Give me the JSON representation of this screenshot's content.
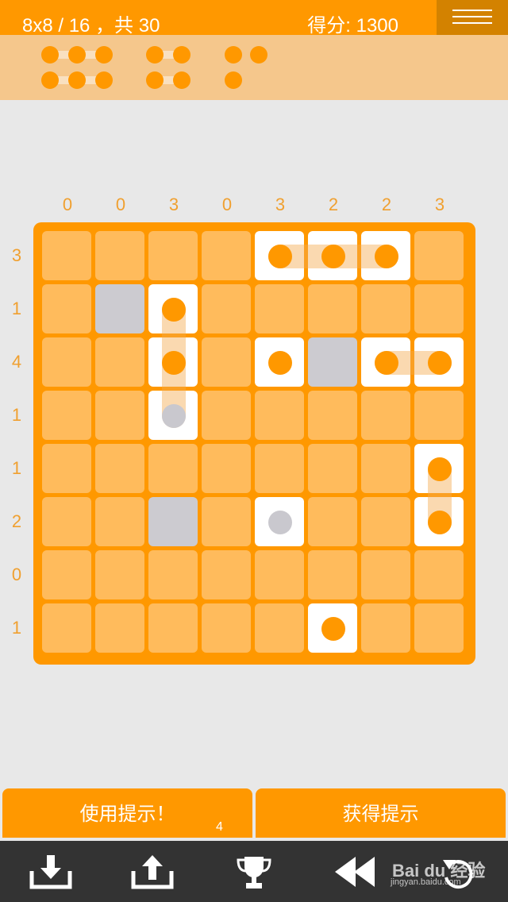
{
  "header": {
    "level_info": "8x8 / 16 ，共 30",
    "score": "得分: 1300",
    "menu_icon": "hamburger-menu-icon"
  },
  "fleet": {
    "ships": [
      {
        "size": 3,
        "found": false
      },
      {
        "size": 3,
        "found": false
      },
      {
        "size": 2,
        "found": false
      },
      {
        "size": 2,
        "found": false
      },
      {
        "size": 1,
        "found": false
      },
      {
        "size": 1,
        "found": false
      },
      {
        "size": 1,
        "found": false
      }
    ]
  },
  "puzzle": {
    "col_clues": [
      "0",
      "0",
      "3",
      "0",
      "3",
      "2",
      "2",
      "3"
    ],
    "row_clues": [
      "3",
      "1",
      "4",
      "1",
      "1",
      "2",
      "0",
      "1"
    ],
    "grid": [
      [
        "e",
        "e",
        "e",
        "e",
        "s",
        "s",
        "s",
        "e"
      ],
      [
        "e",
        "w",
        "s",
        "e",
        "e",
        "e",
        "e",
        "e"
      ],
      [
        "e",
        "e",
        "s",
        "e",
        "s",
        "w",
        "s",
        "s"
      ],
      [
        "e",
        "e",
        "g",
        "e",
        "e",
        "e",
        "e",
        "e"
      ],
      [
        "e",
        "e",
        "e",
        "e",
        "e",
        "e",
        "e",
        "s"
      ],
      [
        "e",
        "e",
        "w",
        "e",
        "g",
        "e",
        "e",
        "s"
      ],
      [
        "e",
        "e",
        "e",
        "e",
        "e",
        "e",
        "e",
        "e"
      ],
      [
        "e",
        "e",
        "e",
        "e",
        "e",
        "s",
        "e",
        "e"
      ]
    ],
    "links": [
      {
        "row": 0,
        "from": 4,
        "to": 6,
        "dir": "h"
      },
      {
        "col": 2,
        "from": 1,
        "to": 3,
        "dir": "v"
      },
      {
        "row": 2,
        "from": 6,
        "to": 7,
        "dir": "h"
      },
      {
        "col": 7,
        "from": 4,
        "to": 5,
        "dir": "v"
      }
    ]
  },
  "actions": {
    "use_hint": "使用提示！",
    "hint_count": "4",
    "get_hints": "获得提示"
  },
  "toolbar": {
    "items": [
      "download-icon",
      "upload-icon",
      "trophy-icon",
      "rewind-icon",
      "undo-icon"
    ]
  },
  "watermark": {
    "text": "Bai du 经验",
    "url": "jingyan.baidu.com"
  },
  "colors": {
    "accent": "#ff9800",
    "cell": "#ffbb5c",
    "water": "#cccbd0",
    "ship": "#ffffff",
    "background": "#e8e8e8",
    "toolbar": "#333333"
  }
}
